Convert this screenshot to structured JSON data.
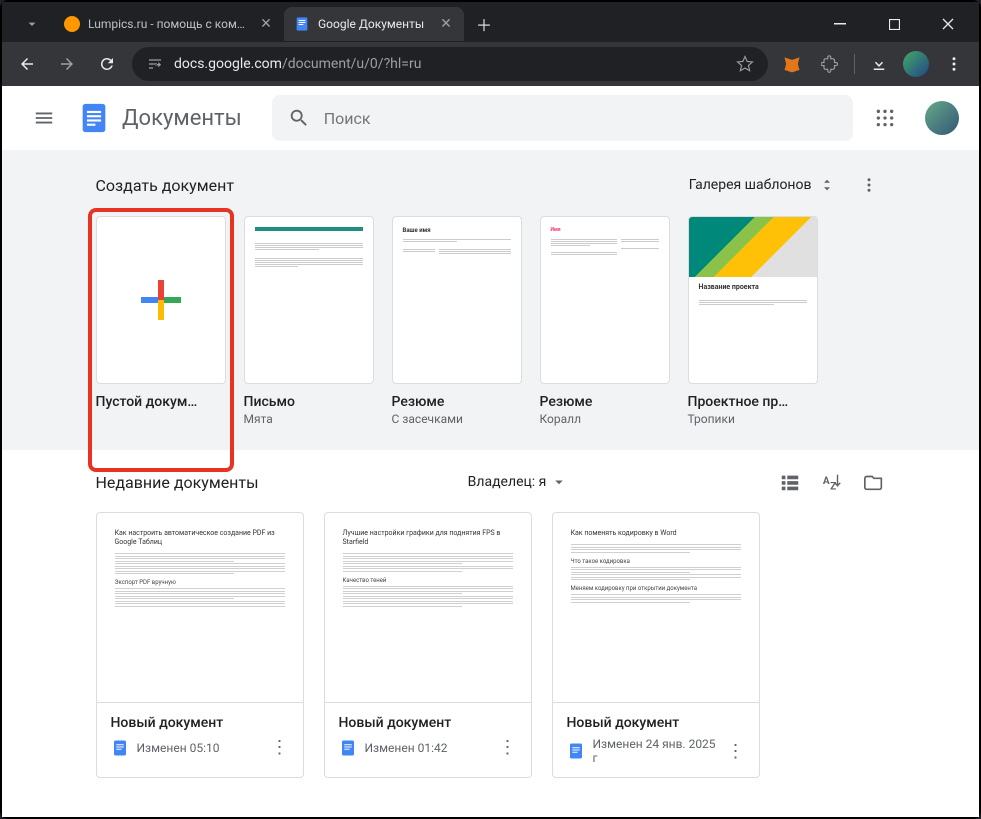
{
  "browser": {
    "tabs": [
      {
        "title": "Lumpics.ru - помощь с компью",
        "favicon_color": "#ff9800"
      },
      {
        "title": "Google Документы",
        "favicon": "docs"
      }
    ],
    "url_host": "docs.google.com",
    "url_path": "/document/u/0/?hl=ru"
  },
  "header": {
    "app_title": "Документы",
    "search_placeholder": "Поиск"
  },
  "templates": {
    "heading": "Создать документ",
    "gallery_label": "Галерея шаблонов",
    "items": [
      {
        "name": "Пустой докум…",
        "subtitle": ""
      },
      {
        "name": "Письмо",
        "subtitle": "Мята"
      },
      {
        "name": "Резюме",
        "subtitle": "С засечками"
      },
      {
        "name": "Резюме",
        "subtitle": "Коралл"
      },
      {
        "name": "Проектное пр…",
        "subtitle": "Тропики",
        "proj_title": "Название проекта"
      }
    ]
  },
  "recent": {
    "heading": "Недавние документы",
    "owner_label": "Владелец: я",
    "docs": [
      {
        "name": "Новый документ",
        "modified": "Изменен 05:10"
      },
      {
        "name": "Новый документ",
        "modified": "Изменен 01:42"
      },
      {
        "name": "Новый документ",
        "modified": "Изменен 24 янв. 2025 г"
      }
    ]
  }
}
